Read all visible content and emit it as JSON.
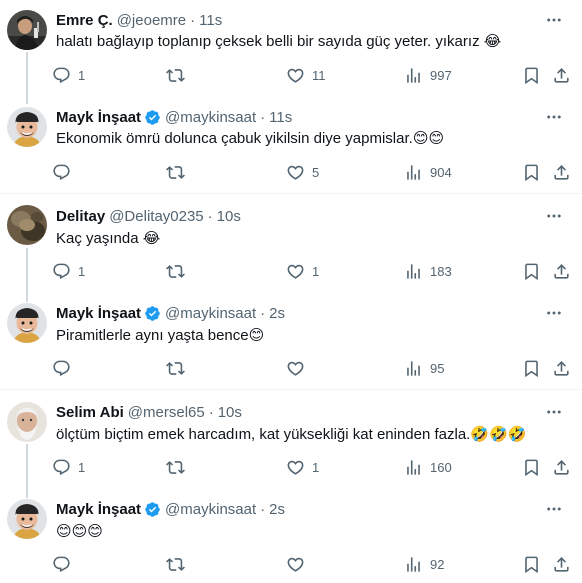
{
  "colors": {
    "accent": "#1d9bf0",
    "muted": "#536471",
    "text": "#0f1419",
    "border": "#eff3f4",
    "thread": "#cfd9de"
  },
  "tweets": [
    {
      "name": "Emre Ç.",
      "handle": "@jeoemre",
      "separator": "·",
      "time": "11s",
      "text": "halatı bağlayıp toplanıp çeksek belli bir sayıda güç yeter. yıkarız 😂",
      "replies": "1",
      "retweets": "",
      "likes": "11",
      "views": "997"
    },
    {
      "name": "Mayk İnşaat",
      "handle": "@maykinsaat",
      "separator": "·",
      "time": "11s",
      "text": "Ekonomik ömrü dolunca çabuk yikilsin diye yapmislar.😊😊",
      "replies": "",
      "retweets": "",
      "likes": "5",
      "views": "904"
    },
    {
      "name": "Delitay",
      "handle": "@Delitay0235",
      "separator": "·",
      "time": "10s",
      "text": "Kaç yaşında 😂",
      "replies": "1",
      "retweets": "",
      "likes": "1",
      "views": "183"
    },
    {
      "name": "Mayk İnşaat",
      "handle": "@maykinsaat",
      "separator": "·",
      "time": "2s",
      "text": "Piramitlerle aynı yaşta bence😊",
      "replies": "",
      "retweets": "",
      "likes": "",
      "views": "95"
    },
    {
      "name": "Selim Abi",
      "handle": "@mersel65",
      "separator": "·",
      "time": "10s",
      "text": "ölçtüm biçtim emek harcadım, kat yüksekliği kat eninden fazla.🤣🤣🤣",
      "replies": "1",
      "retweets": "",
      "likes": "1",
      "views": "160"
    },
    {
      "name": "Mayk İnşaat",
      "handle": "@maykinsaat",
      "separator": "·",
      "time": "2s",
      "text": "😊😊😊",
      "replies": "",
      "retweets": "",
      "likes": "",
      "views": "92"
    }
  ]
}
